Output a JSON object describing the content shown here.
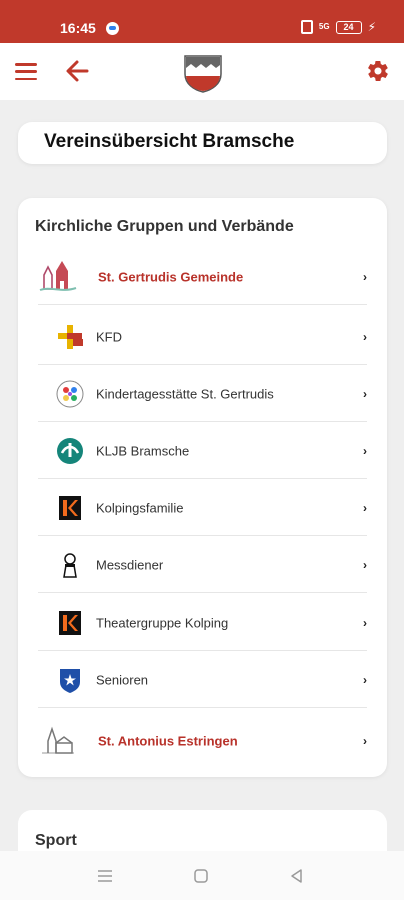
{
  "status_bar": {
    "time": "16:45",
    "network": "5G",
    "battery": "24"
  },
  "app_bar": {
    "menu_icon": "menu-icon",
    "back_icon": "arrow-left-icon",
    "logo": "bramsche-crest",
    "settings_icon": "gear-icon"
  },
  "page_title": "Vereinsübersicht Bramsche",
  "groups": {
    "title": "Kirchliche Gruppen und Verbände",
    "items": [
      {
        "label": "St. Gertrudis Gemeinde",
        "type": "parent",
        "icon": "church-logo"
      },
      {
        "label": "KFD",
        "type": "child",
        "icon": "kfd-logo"
      },
      {
        "label": "Kindertagesstätte St. Gertrudis",
        "type": "child",
        "icon": "kita-logo"
      },
      {
        "label": "KLJB Bramsche",
        "type": "child",
        "icon": "kljb-logo"
      },
      {
        "label": "Kolpingsfamilie",
        "type": "child",
        "icon": "kolping-logo"
      },
      {
        "label": "Messdiener",
        "type": "child",
        "icon": "messdiener-logo"
      },
      {
        "label": "Theatergruppe Kolping",
        "type": "child",
        "icon": "kolping-logo"
      },
      {
        "label": "Senioren",
        "type": "child",
        "icon": "senioren-logo"
      },
      {
        "label": "St. Antonius Estringen",
        "type": "parent",
        "icon": "chapel-logo"
      }
    ]
  },
  "sport": {
    "title": "Sport"
  },
  "colors": {
    "accent": "#c0392b",
    "background": "#efefef"
  }
}
